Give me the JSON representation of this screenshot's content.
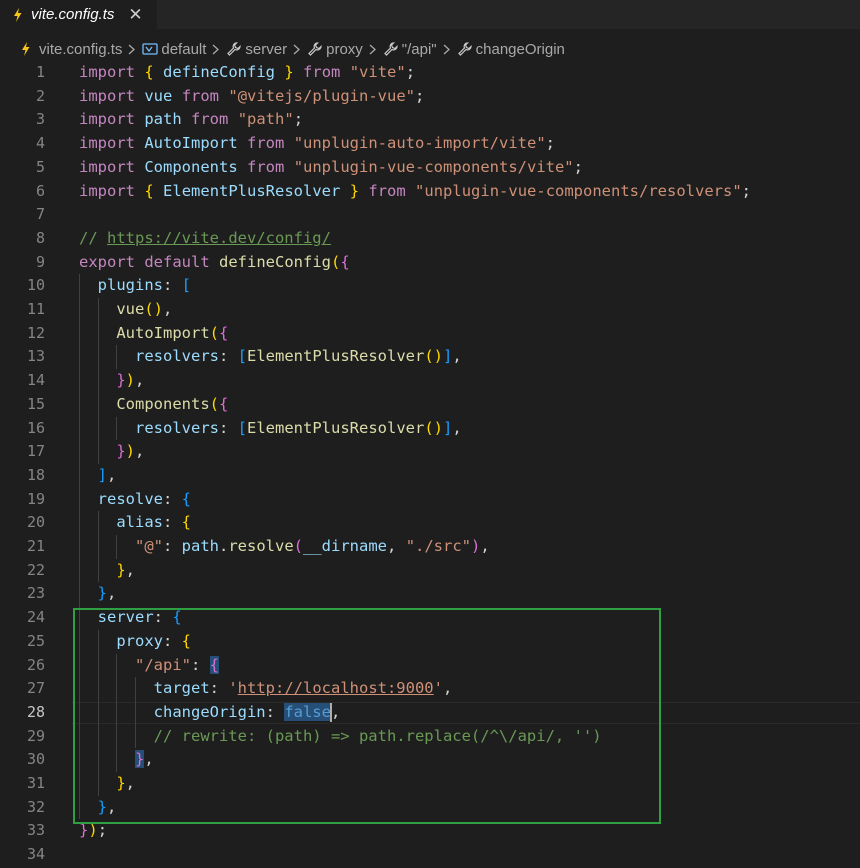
{
  "tab": {
    "label": "vite.config.ts",
    "close": "✕"
  },
  "breadcrumb": {
    "file": "vite.config.ts",
    "items": [
      "default",
      "server",
      "proxy",
      "\"/api\"",
      "changeOrigin"
    ]
  },
  "editor": {
    "active_line": 28,
    "lines": [
      [
        [
          "k",
          "import"
        ],
        [
          "p",
          " "
        ],
        [
          "b1",
          "{"
        ],
        [
          "p",
          " "
        ],
        [
          "v",
          "defineConfig"
        ],
        [
          "p",
          " "
        ],
        [
          "b1",
          "}"
        ],
        [
          "p",
          " "
        ],
        [
          "k",
          "from"
        ],
        [
          "p",
          " "
        ],
        [
          "s",
          "\"vite\""
        ],
        [
          "p",
          ";"
        ]
      ],
      [
        [
          "k",
          "import"
        ],
        [
          "p",
          " "
        ],
        [
          "v",
          "vue"
        ],
        [
          "p",
          " "
        ],
        [
          "k",
          "from"
        ],
        [
          "p",
          " "
        ],
        [
          "s",
          "\"@vitejs/plugin-vue\""
        ],
        [
          "p",
          ";"
        ]
      ],
      [
        [
          "k",
          "import"
        ],
        [
          "p",
          " "
        ],
        [
          "v",
          "path"
        ],
        [
          "p",
          " "
        ],
        [
          "k",
          "from"
        ],
        [
          "p",
          " "
        ],
        [
          "s",
          "\"path\""
        ],
        [
          "p",
          ";"
        ]
      ],
      [
        [
          "k",
          "import"
        ],
        [
          "p",
          " "
        ],
        [
          "v",
          "AutoImport"
        ],
        [
          "p",
          " "
        ],
        [
          "k",
          "from"
        ],
        [
          "p",
          " "
        ],
        [
          "s",
          "\"unplugin-auto-import/vite\""
        ],
        [
          "p",
          ";"
        ]
      ],
      [
        [
          "k",
          "import"
        ],
        [
          "p",
          " "
        ],
        [
          "v",
          "Components"
        ],
        [
          "p",
          " "
        ],
        [
          "k",
          "from"
        ],
        [
          "p",
          " "
        ],
        [
          "s",
          "\"unplugin-vue-components/vite\""
        ],
        [
          "p",
          ";"
        ]
      ],
      [
        [
          "k",
          "import"
        ],
        [
          "p",
          " "
        ],
        [
          "b1",
          "{"
        ],
        [
          "p",
          " "
        ],
        [
          "v",
          "ElementPlusResolver"
        ],
        [
          "p",
          " "
        ],
        [
          "b1",
          "}"
        ],
        [
          "p",
          " "
        ],
        [
          "k",
          "from"
        ],
        [
          "p",
          " "
        ],
        [
          "s",
          "\"unplugin-vue-components/resolvers\""
        ],
        [
          "p",
          ";"
        ]
      ],
      [],
      [
        [
          "c",
          "// "
        ],
        [
          "c url",
          "https://vite.dev/config/"
        ]
      ],
      [
        [
          "k",
          "export"
        ],
        [
          "p",
          " "
        ],
        [
          "k",
          "default"
        ],
        [
          "p",
          " "
        ],
        [
          "f",
          "defineConfig"
        ],
        [
          "b1",
          "("
        ],
        [
          "b2",
          "{"
        ]
      ],
      [
        [
          "p",
          "  "
        ],
        [
          "v",
          "plugins"
        ],
        [
          "p",
          ": "
        ],
        [
          "b3",
          "["
        ]
      ],
      [
        [
          "p",
          "    "
        ],
        [
          "f",
          "vue"
        ],
        [
          "b1",
          "()"
        ],
        [
          "p",
          ","
        ]
      ],
      [
        [
          "p",
          "    "
        ],
        [
          "f",
          "AutoImport"
        ],
        [
          "b1",
          "("
        ],
        [
          "b2",
          "{"
        ]
      ],
      [
        [
          "p",
          "      "
        ],
        [
          "v",
          "resolvers"
        ],
        [
          "p",
          ": "
        ],
        [
          "b3",
          "["
        ],
        [
          "f",
          "ElementPlusResolver"
        ],
        [
          "b1",
          "()"
        ],
        [
          "b3",
          "]"
        ],
        [
          "p",
          ","
        ]
      ],
      [
        [
          "p",
          "    "
        ],
        [
          "b2",
          "}"
        ],
        [
          "b1",
          ")"
        ],
        [
          "p",
          ","
        ]
      ],
      [
        [
          "p",
          "    "
        ],
        [
          "f",
          "Components"
        ],
        [
          "b1",
          "("
        ],
        [
          "b2",
          "{"
        ]
      ],
      [
        [
          "p",
          "      "
        ],
        [
          "v",
          "resolvers"
        ],
        [
          "p",
          ": "
        ],
        [
          "b3",
          "["
        ],
        [
          "f",
          "ElementPlusResolver"
        ],
        [
          "b1",
          "()"
        ],
        [
          "b3",
          "]"
        ],
        [
          "p",
          ","
        ]
      ],
      [
        [
          "p",
          "    "
        ],
        [
          "b2",
          "}"
        ],
        [
          "b1",
          ")"
        ],
        [
          "p",
          ","
        ]
      ],
      [
        [
          "p",
          "  "
        ],
        [
          "b3",
          "]"
        ],
        [
          "p",
          ","
        ]
      ],
      [
        [
          "p",
          "  "
        ],
        [
          "v",
          "resolve"
        ],
        [
          "p",
          ": "
        ],
        [
          "b3",
          "{"
        ]
      ],
      [
        [
          "p",
          "    "
        ],
        [
          "v",
          "alias"
        ],
        [
          "p",
          ": "
        ],
        [
          "b1",
          "{"
        ]
      ],
      [
        [
          "p",
          "      "
        ],
        [
          "s",
          "\"@\""
        ],
        [
          "p",
          ": "
        ],
        [
          "v",
          "path"
        ],
        [
          "p",
          "."
        ],
        [
          "f",
          "resolve"
        ],
        [
          "b2",
          "("
        ],
        [
          "v",
          "__dirname"
        ],
        [
          "p",
          ", "
        ],
        [
          "s",
          "\"./src\""
        ],
        [
          "b2",
          ")"
        ],
        [
          "p",
          ","
        ]
      ],
      [
        [
          "p",
          "    "
        ],
        [
          "b1",
          "}"
        ],
        [
          "p",
          ","
        ]
      ],
      [
        [
          "p",
          "  "
        ],
        [
          "b3",
          "}"
        ],
        [
          "p",
          ","
        ]
      ],
      [
        [
          "p",
          "  "
        ],
        [
          "v",
          "server"
        ],
        [
          "p",
          ": "
        ],
        [
          "b3",
          "{"
        ]
      ],
      [
        [
          "p",
          "    "
        ],
        [
          "v",
          "proxy"
        ],
        [
          "p",
          ": "
        ],
        [
          "b1",
          "{"
        ]
      ],
      [
        [
          "p",
          "      "
        ],
        [
          "s",
          "\"/api\""
        ],
        [
          "p",
          ": "
        ],
        [
          "b2 sel",
          "{"
        ]
      ],
      [
        [
          "p",
          "        "
        ],
        [
          "v",
          "target"
        ],
        [
          "p",
          ": "
        ],
        [
          "s",
          "'"
        ],
        [
          "s url",
          "http://localhost:9000"
        ],
        [
          "s",
          "'"
        ],
        [
          "p",
          ","
        ]
      ],
      [
        [
          "p",
          "        "
        ],
        [
          "v",
          "changeOrigin"
        ],
        [
          "p",
          ": "
        ],
        [
          "kw sel",
          "false"
        ],
        [
          "cursor",
          ""
        ],
        [
          "p",
          ","
        ]
      ],
      [
        [
          "p",
          "        "
        ],
        [
          "c",
          "// rewrite: (path) => path.replace(/^\\/api/, '')"
        ]
      ],
      [
        [
          "p",
          "      "
        ],
        [
          "b2 sel",
          "}"
        ],
        [
          "p",
          ","
        ]
      ],
      [
        [
          "p",
          "    "
        ],
        [
          "b1",
          "}"
        ],
        [
          "p",
          ","
        ]
      ],
      [
        [
          "p",
          "  "
        ],
        [
          "b3",
          "}"
        ],
        [
          "p",
          ","
        ]
      ],
      [
        [
          "b2",
          "}"
        ],
        [
          "b1",
          ")"
        ],
        [
          "p",
          ";"
        ]
      ],
      []
    ]
  },
  "colors": {
    "background": "#1e1e1e",
    "highlight_box": "#2ea043",
    "tab_icon": "#f5c518"
  },
  "icons": [
    "vite-lightning-icon",
    "close-icon",
    "symbol-variable-icon",
    "wrench-icon",
    "chevron-right-icon"
  ]
}
